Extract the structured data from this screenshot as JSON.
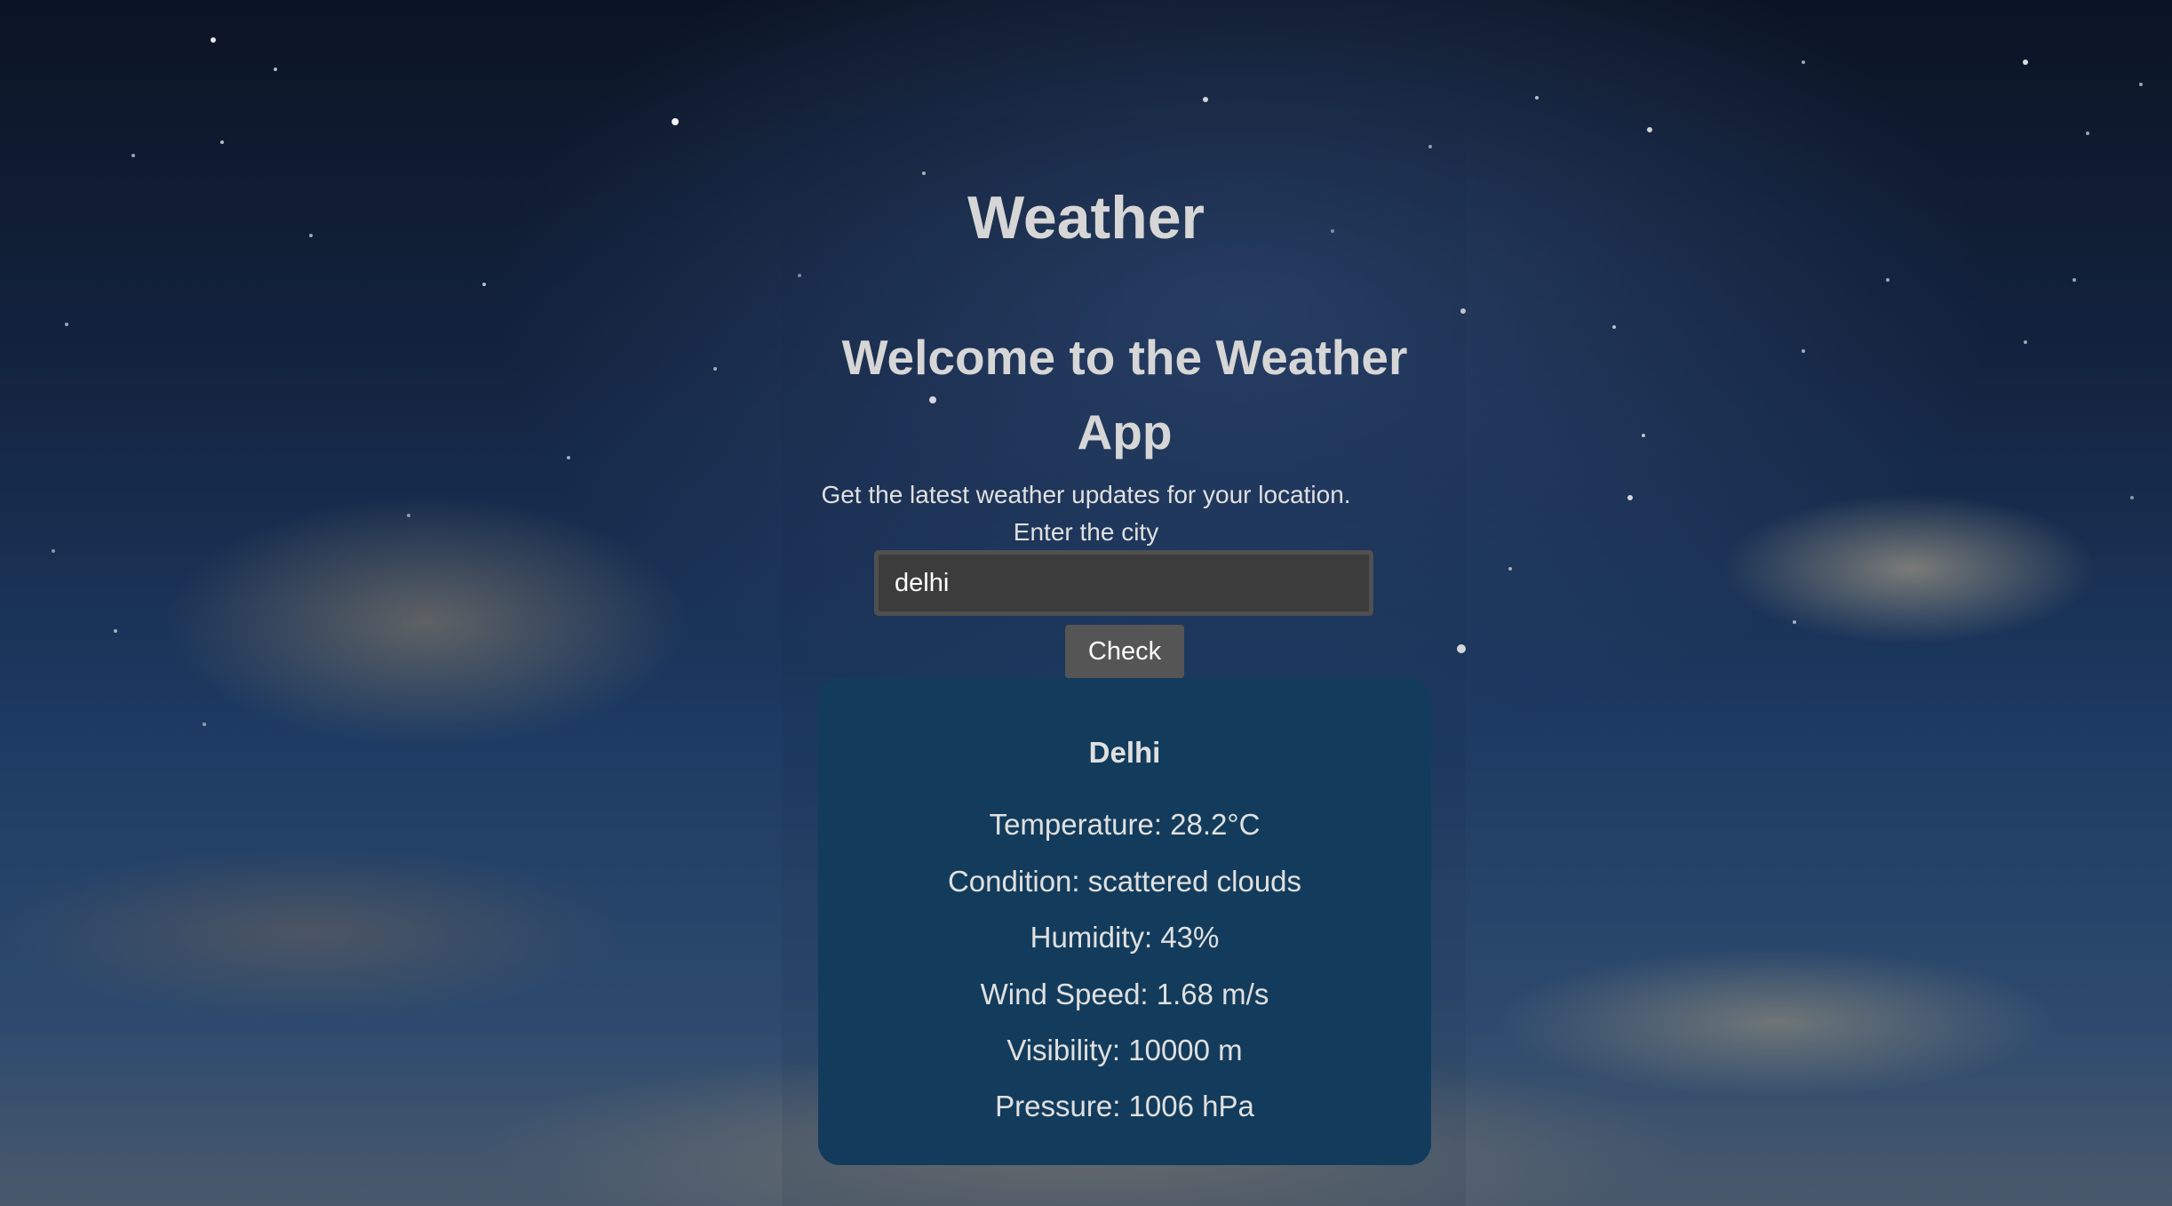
{
  "header": {
    "title": "Weather"
  },
  "intro": {
    "welcome": "Welcome to the Weather App",
    "tagline": "Get the latest weather updates for your location."
  },
  "search": {
    "label": "Enter the city",
    "value": "delhi",
    "button_label": "Check"
  },
  "result": {
    "city": "Delhi",
    "temperature": "Temperature: 28.2°C",
    "condition": "Condition: scattered clouds",
    "humidity": "Humidity: 43%",
    "wind_speed": "Wind Speed: 1.68 m/s",
    "visibility": "Visibility: 10000 m",
    "pressure": "Pressure: 1006 hPa"
  },
  "colors": {
    "card_background": "#133c5c",
    "input_background": "#3c3c3c",
    "button_background": "#555555",
    "heading_text": "#d6d6d6"
  }
}
